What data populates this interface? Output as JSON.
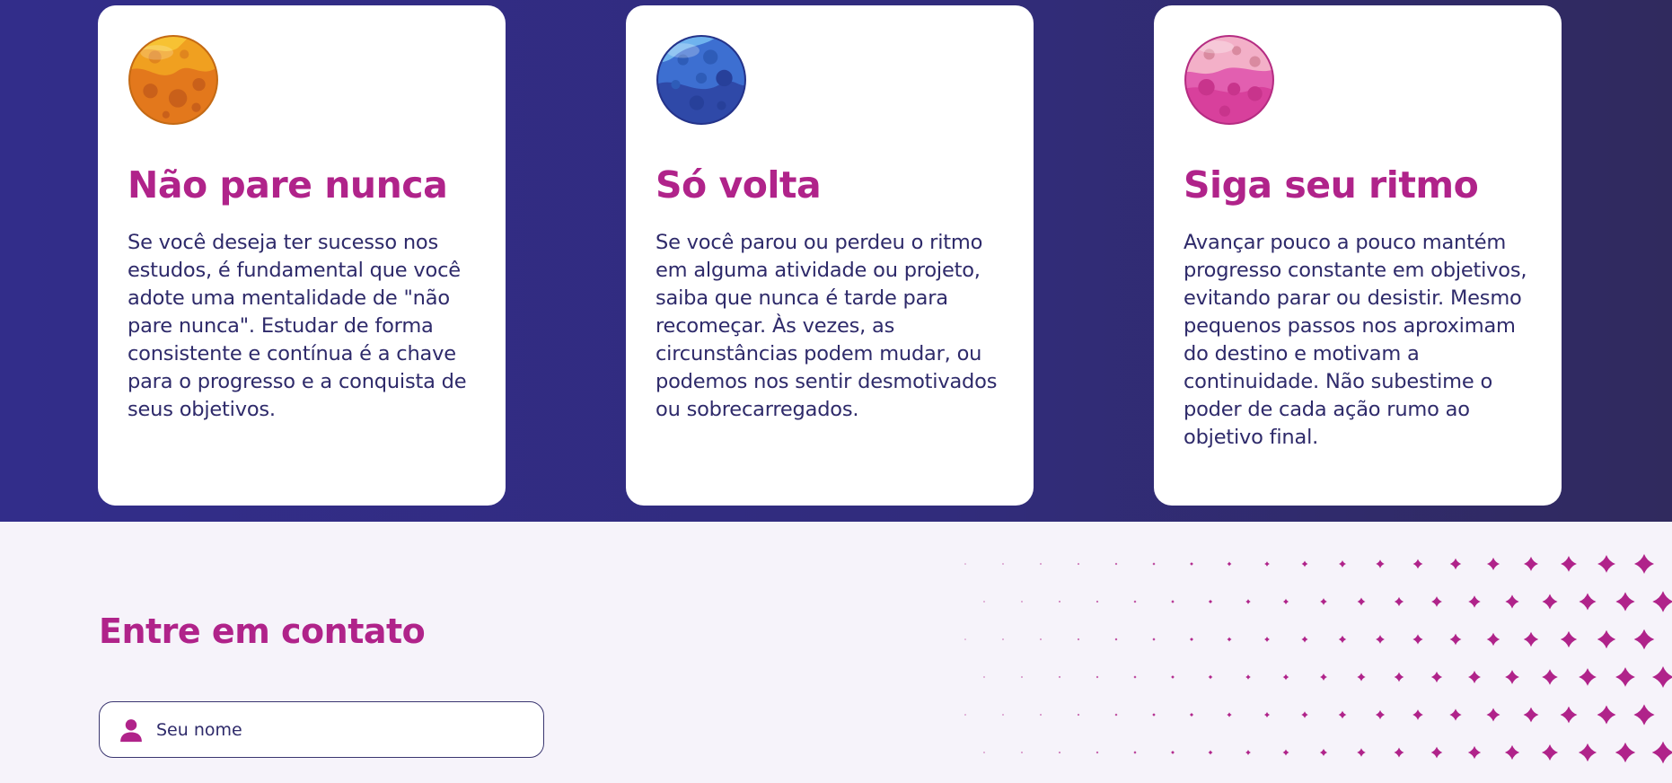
{
  "cards": [
    {
      "title": "Não pare nunca",
      "text": "Se você deseja ter sucesso nos estudos, é fundamental que você adote uma mentalidade de \"não pare nunca\". Estudar de forma consistente e contínua é a chave para o progresso e a conquista de seus objetivos.",
      "icon": "orange-planet-icon"
    },
    {
      "title": "Só volta",
      "text": "Se você parou ou perdeu o ritmo em alguma atividade ou projeto, saiba que nunca é tarde para recomeçar. Às vezes, as circunstâncias podem mudar, ou podemos nos sentir desmotivados ou sobrecarregados.",
      "icon": "blue-planet-icon"
    },
    {
      "title": "Siga seu ritmo",
      "text": "Avançar pouco a pouco mantém progresso constante em objetivos, evitando parar ou desistir. Mesmo pequenos passos nos aproximam do destino e motivam a continuidade. Não subestime o poder de cada ação rumo ao objetivo final.",
      "icon": "pink-planet-icon"
    }
  ],
  "contact": {
    "title": "Entre em contato",
    "name_placeholder": "Seu nome",
    "name_value": ""
  },
  "colors": {
    "accent": "#b0238a",
    "text": "#2e2a6a",
    "top_bg": "#322d8a",
    "bottom_bg": "#f6f3fa"
  },
  "icons": {
    "field_icon": "user-icon",
    "decoration": "sparkle-star-icon"
  }
}
